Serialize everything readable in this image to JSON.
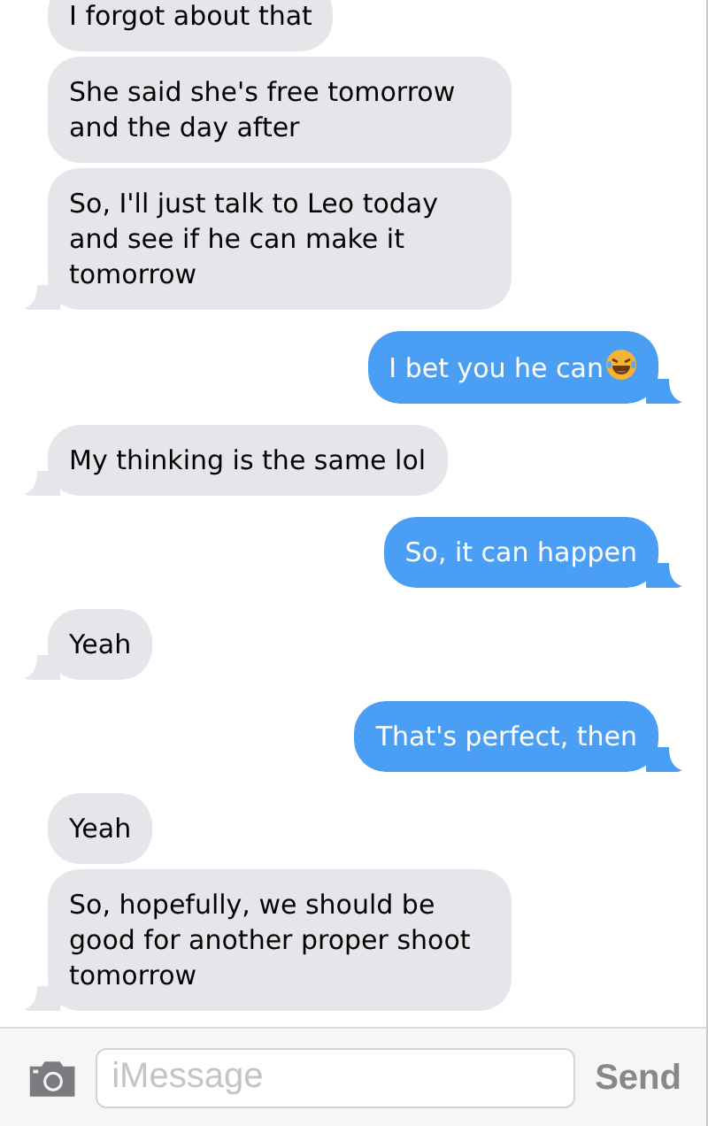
{
  "messages": [
    {
      "kind": "incoming",
      "parts": [
        {
          "kind": "text",
          "text": "I forgot about that"
        }
      ],
      "tail": false
    },
    {
      "kind": "incoming",
      "parts": [
        {
          "kind": "text",
          "text": "She said she's free tomorrow and the day after"
        }
      ],
      "tail": false
    },
    {
      "kind": "incoming",
      "parts": [
        {
          "kind": "text",
          "text": "So, I'll just talk to Leo today and see if he can make it tomorrow"
        }
      ],
      "tail": true
    },
    {
      "kind": "outgoing",
      "parts": [
        {
          "kind": "text",
          "text": "I bet you he can"
        },
        {
          "kind": "emoji"
        }
      ],
      "tail": true
    },
    {
      "kind": "incoming",
      "parts": [
        {
          "kind": "text",
          "text": "My thinking is the same lol"
        }
      ],
      "tail": true
    },
    {
      "kind": "outgoing",
      "parts": [
        {
          "kind": "text",
          "text": "So, it can happen"
        }
      ],
      "tail": true
    },
    {
      "kind": "incoming",
      "parts": [
        {
          "kind": "text",
          "text": "Yeah"
        }
      ],
      "tail": true
    },
    {
      "kind": "outgoing",
      "parts": [
        {
          "kind": "text",
          "text": "That's perfect, then"
        }
      ],
      "tail": true
    },
    {
      "kind": "incoming",
      "parts": [
        {
          "kind": "text",
          "text": "Yeah"
        }
      ],
      "tail": false
    },
    {
      "kind": "incoming",
      "parts": [
        {
          "kind": "text",
          "text": "So, hopefully, we should be good for another proper shoot tomorrow"
        }
      ],
      "tail": true
    }
  ],
  "composer": {
    "placeholder": "iMessage",
    "send_label": "Send"
  }
}
